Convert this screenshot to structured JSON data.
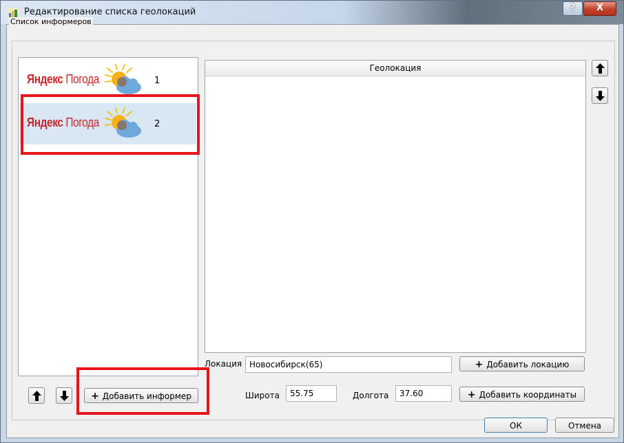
{
  "window": {
    "title": "Редактирование списка геолокаций",
    "help_glyph": "?",
    "close_glyph": "X"
  },
  "group": {
    "title": "Список информеров"
  },
  "informers": [
    {
      "logo_part1": "Яндекс",
      "logo_part2": "Погода",
      "number": "1",
      "selected": false
    },
    {
      "logo_part1": "Яндекс",
      "logo_part2": "Погода",
      "number": "2",
      "selected": true
    }
  ],
  "geo_table": {
    "column_header": "Геолокация"
  },
  "location": {
    "label": "Локация",
    "value": "Новосибирск(65)",
    "add_button": "Добавить локацию"
  },
  "coordinates": {
    "lat_label": "Широта",
    "lat_value": "55.75",
    "lon_label": "Долгота",
    "lon_value": "37.60",
    "add_button": "Добавить координаты"
  },
  "informer_actions": {
    "add_button": "Добавить информер"
  },
  "dialog_buttons": {
    "ok": "ОК",
    "cancel": "Отмена"
  },
  "icons": [
    "app-icon",
    "sun-cloud-icon",
    "arrow-up-icon",
    "arrow-down-icon",
    "plus-icon"
  ],
  "colors": {
    "highlight": "#e8141a",
    "brand_red": "#c5272c",
    "selection": "#d9e7f5"
  }
}
